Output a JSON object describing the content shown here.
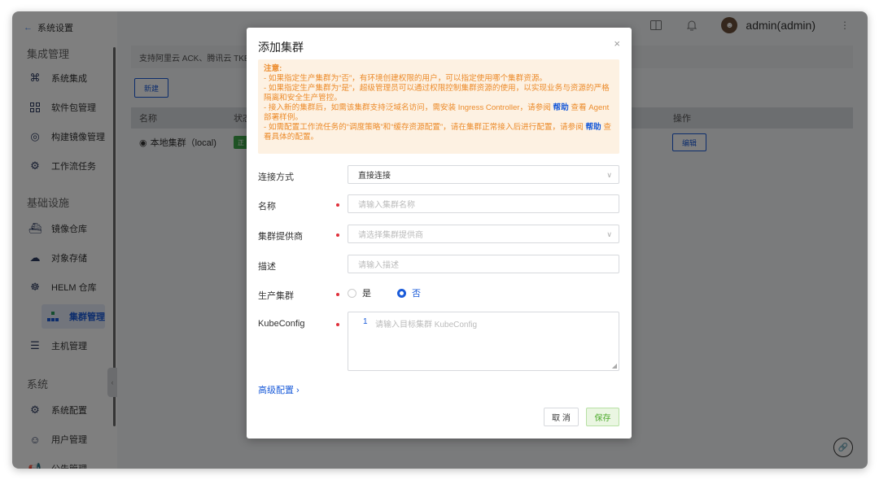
{
  "sidebar": {
    "back_label": "系统设置",
    "sections": [
      "集成管理",
      "基础设施",
      "系统"
    ],
    "items": [
      {
        "label": "系统集成",
        "icon": "command-icon"
      },
      {
        "label": "软件包管理",
        "icon": "grid-icon"
      },
      {
        "label": "构建镜像管理",
        "icon": "disc-icon"
      },
      {
        "label": "工作流任务",
        "icon": "workflow-icon"
      },
      {
        "label": "镜像仓库",
        "icon": "ship-icon"
      },
      {
        "label": "对象存储",
        "icon": "cloud-icon"
      },
      {
        "label": "HELM 仓库",
        "icon": "helm-icon"
      },
      {
        "label": "集群管理",
        "icon": "cluster-icon",
        "active": true
      },
      {
        "label": "主机管理",
        "icon": "server-icon"
      },
      {
        "label": "系统配置",
        "icon": "config-icon"
      },
      {
        "label": "用户管理",
        "icon": "user-icon"
      },
      {
        "label": "公告管理",
        "icon": "megaphone-icon"
      }
    ]
  },
  "topbar": {
    "user_name": "admin(admin)"
  },
  "main": {
    "info_text": "支持阿里云 ACK、腾讯云 TKE",
    "new_button": "新建",
    "table_headers": [
      "名称",
      "状态",
      "操作"
    ],
    "row_name": "本地集群（local)",
    "row_status": "正",
    "edit_button": "编辑"
  },
  "modal": {
    "title": "添加集群",
    "notice": {
      "title": "注意:",
      "line1": "- 如果指定生产集群为“否”，有环境创建权限的用户，可以指定使用哪个集群资源。",
      "line2": "- 如果指定生产集群为“是”，超级管理员可以通过权限控制集群资源的使用，以实现业务与资源的严格隔离和安全生产管控。",
      "line3a": "- 接入新的集群后，如需该集群支持泛域名访问，需安装 Ingress Controller，请参阅 ",
      "line3_link": "帮助",
      "line3b": " 查看 Agent 部署样例。",
      "line4": "- 如需配置工作流任务的“调度策略”和“缓存资源配置”，请在集群正常接入后进行配置，请参阅 ",
      "line4_link": "帮助",
      "line4b": " 查看具体的配置。"
    },
    "fields": {
      "connect_label": "连接方式",
      "connect_value": "直接连接",
      "name_label": "名称",
      "name_placeholder": "请输入集群名称",
      "provider_label": "集群提供商",
      "provider_placeholder": "请选择集群提供商",
      "desc_label": "描述",
      "desc_placeholder": "请输入描述",
      "prod_label": "生产集群",
      "prod_yes": "是",
      "prod_no": "否",
      "prod_selected": "否",
      "kube_label": "KubeConfig",
      "kube_line_no": "1",
      "kube_placeholder": "请输入目标集群 KubeConfig"
    },
    "advanced": "高级配置 ›",
    "cancel": "取 消",
    "save": "保存"
  }
}
